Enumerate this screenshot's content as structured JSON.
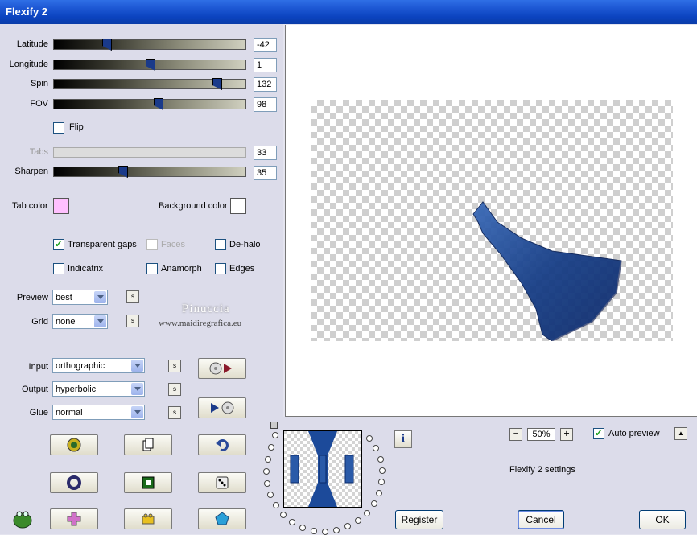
{
  "window": {
    "title": "Flexify 2"
  },
  "sliders": [
    {
      "label": "Latitude",
      "value": "-42",
      "level": 0.28
    },
    {
      "label": "Longitude",
      "value": "1",
      "level": 0.5
    },
    {
      "label": "Spin",
      "value": "132",
      "level": 0.85
    },
    {
      "label": "FOV",
      "value": "98",
      "level": 0.54
    }
  ],
  "flip": {
    "label": "Flip",
    "checked": false
  },
  "tabs": {
    "label": "Tabs",
    "value": "33",
    "disabled": true
  },
  "sharpen": {
    "label": "Sharpen",
    "value": "35",
    "level": 0.35
  },
  "tab_color": {
    "label": "Tab color",
    "color": "#ffc0ff"
  },
  "background_color": {
    "label": "Background color",
    "color": "#ffffff"
  },
  "options": {
    "transparent_gaps": {
      "label": "Transparent gaps",
      "checked": true
    },
    "faces": {
      "label": "Faces",
      "checked": false,
      "disabled": true
    },
    "de_halo": {
      "label": "De-halo",
      "checked": false
    },
    "indicatrix": {
      "label": "Indicatrix",
      "checked": false
    },
    "anamorph": {
      "label": "Anamorph",
      "checked": false
    },
    "edges": {
      "label": "Edges",
      "checked": false
    }
  },
  "preview_select": {
    "label": "Preview",
    "value": "best"
  },
  "grid_select": {
    "label": "Grid",
    "value": "none"
  },
  "input_select": {
    "label": "Input",
    "value": "orthographic"
  },
  "output_select": {
    "label": "Output",
    "value": "hyperbolic"
  },
  "glue_select": {
    "label": "Glue",
    "value": "normal"
  },
  "s_label": "s",
  "watermark": {
    "name": "Pinuccia",
    "site": "www.maidiregrafica.eu"
  },
  "zoom": {
    "value": "50%",
    "minus": "−",
    "plus": "+"
  },
  "auto_preview": {
    "label": "Auto preview",
    "checked": true
  },
  "settings_text": "Flexify 2 settings",
  "buttons": {
    "register": "Register",
    "cancel": "Cancel",
    "ok": "OK",
    "info": "i",
    "collapse": "▲"
  }
}
